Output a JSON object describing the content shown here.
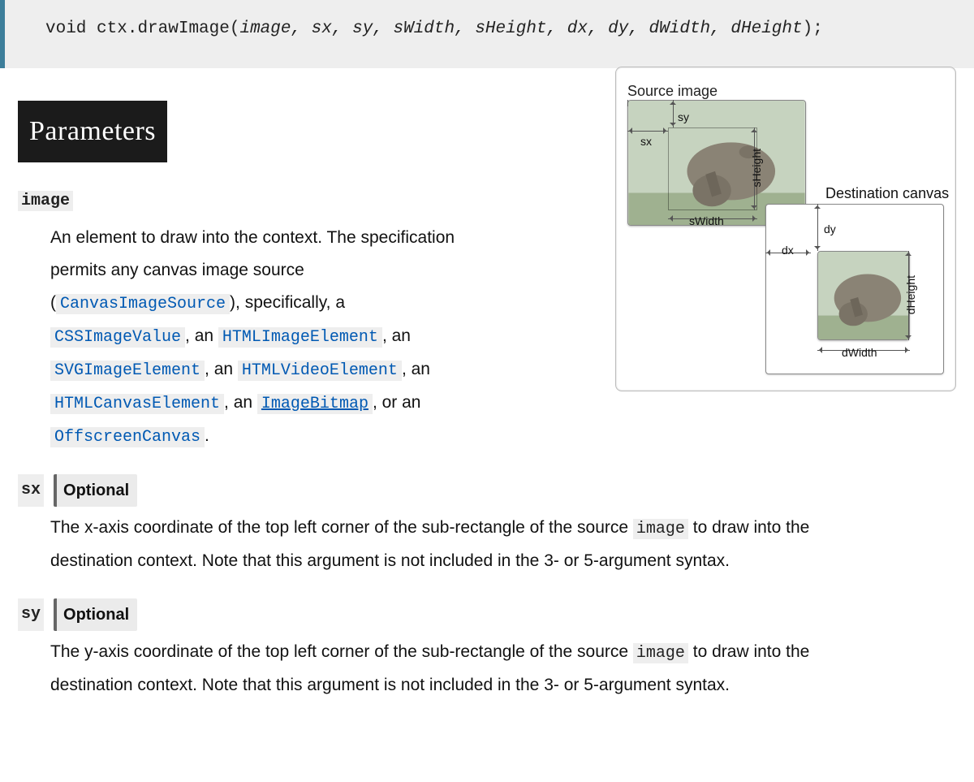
{
  "signature": {
    "keyword": "void",
    "call": "ctx.drawImage(",
    "args": "image, sx, sy, sWidth, sHeight, dx, dy, dWidth, dHeight",
    "close": ");"
  },
  "headings": {
    "parameters": "Parameters"
  },
  "diagram": {
    "source_caption": "Source image",
    "dest_caption": "Destination canvas",
    "sx": "sx",
    "sy": "sy",
    "sWidth": "sWidth",
    "sHeight": "sHeight",
    "dx": "dx",
    "dy": "dy",
    "dWidth": "dWidth",
    "dHeight": "dHeight"
  },
  "params": {
    "image": {
      "name": "image",
      "desc_prefix": "An element to draw into the context. The specification permits any canvas image source (",
      "canvas_image_source": "CanvasImageSource",
      "desc_mid1": "), specifically, a ",
      "css_image_value": "CSSImageValue",
      "comma_an1": ", an ",
      "html_image_element": "HTMLImageElement",
      "comma_an2": ", an ",
      "svg_image_element": "SVGImageElement",
      "comma_an3": ", an ",
      "html_video_element": "HTMLVideoElement",
      "comma_an4": ", an ",
      "html_canvas_element": "HTMLCanvasElement",
      "comma_an5": ", an ",
      "image_bitmap": "ImageBitmap",
      "comma_or_an": ", or an ",
      "offscreen_canvas": "OffscreenCanvas",
      "period": "."
    },
    "sx": {
      "name": "sx",
      "badge": "Optional",
      "desc_pre": "The x-axis coordinate of the top left corner of the sub-rectangle of the source ",
      "image_code": "image",
      "desc_post": " to draw into the destination context. Note that this argument is not included in the 3- or 5-argument syntax."
    },
    "sy": {
      "name": "sy",
      "badge": "Optional",
      "desc_pre": "The y-axis coordinate of the top left corner of the sub-rectangle of the source ",
      "image_code": "image",
      "desc_post": " to draw into the destination context. Note that this argument is not included in the 3- or 5-argument syntax."
    }
  }
}
